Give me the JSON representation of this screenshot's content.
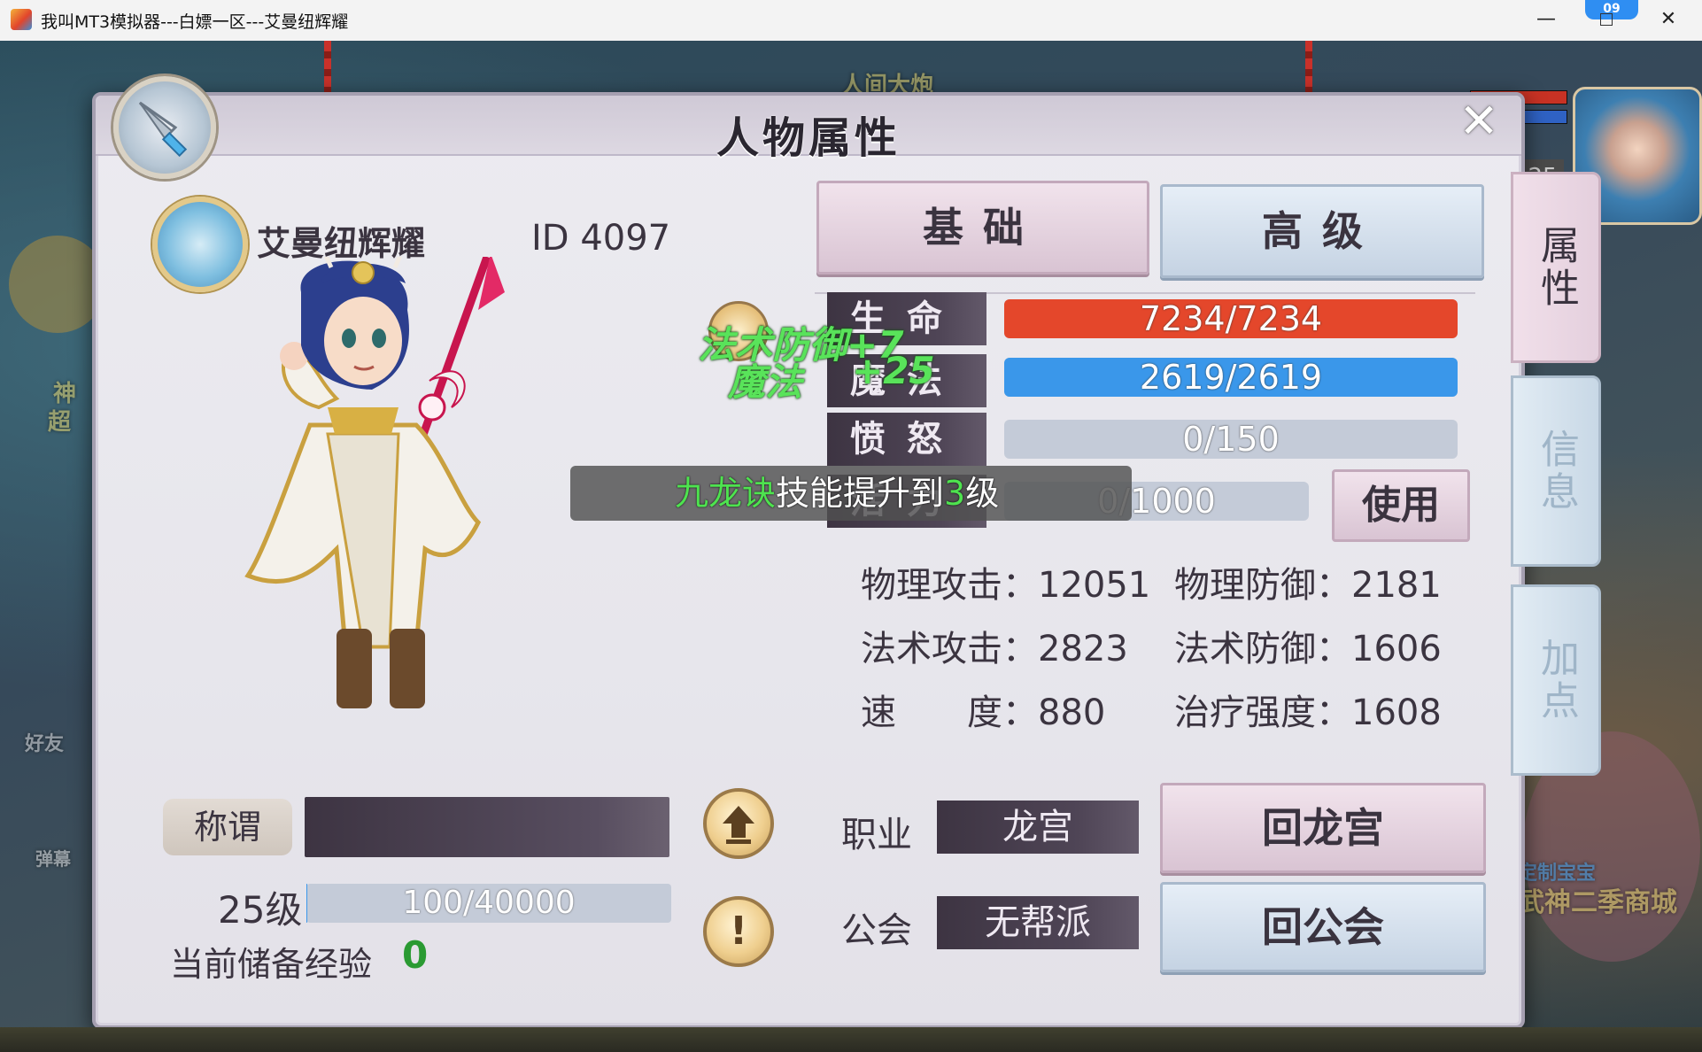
{
  "window": {
    "title": "我叫MT3模拟器---白嫖一区---艾曼纽辉耀",
    "minimize": "—",
    "close": "✕",
    "badge": "09"
  },
  "background": {
    "left_text_1": "神",
    "left_text_2": "超",
    "left_text_3": "好友",
    "left_text_4": "弹幕",
    "right_text_1": "定制宝宝",
    "right_text_2": "武神二季商城",
    "top_text": "人间大炮",
    "hud_level": "25",
    "bottom_left": "经验"
  },
  "panel": {
    "title": "人物属性",
    "close": "✕"
  },
  "character": {
    "name": "艾曼纽辉耀",
    "id": "ID 4097"
  },
  "tabs": {
    "basic": "基础",
    "advanced": "高级"
  },
  "side_tabs": {
    "attributes": "属性",
    "info": "信息",
    "add_points": "加点"
  },
  "stats": {
    "hp_label": "生命",
    "hp_value": "7234/7234",
    "hp_ratio": 1.0,
    "mp_label": "魔法",
    "mp_value": "2619/2619",
    "mp_ratio": 1.0,
    "rage_label": "愤怒",
    "rage_value": "0/150",
    "rage_ratio": 0,
    "vit_label": "活力",
    "vit_value": "0/1000",
    "vit_ratio": 0,
    "use_button": "使用"
  },
  "attributes": {
    "phys_atk_label": "物理攻击：",
    "phys_atk": "12051",
    "phys_def_label": "物理防御：",
    "phys_def": "2181",
    "mag_atk_label": "法术攻击：",
    "mag_atk": "2823",
    "mag_def_label": "法术防御：",
    "mag_def": "1606",
    "speed_label": "速　　度：",
    "speed": "880",
    "heal_label": "治疗强度：",
    "heal": "1608"
  },
  "floating": {
    "line1": "法术防御+7",
    "line2a": "魔法",
    "line2b": "+25"
  },
  "toast": {
    "skill": "九龙诀",
    "middle": "技能提升到",
    "level": "3",
    "suffix": "级"
  },
  "bottom": {
    "title_label": "称谓",
    "level": "25级",
    "exp": "100/40000",
    "exp_ratio": 0.0025,
    "reserve_label": "当前储备经验",
    "reserve_value": "0",
    "job_label": "职业",
    "job_value": "龙宫",
    "guild_label": "公会",
    "guild_value": "无帮派",
    "return_dragon": "回龙宫",
    "return_guild": "回公会"
  },
  "colors": {
    "hp": "#e4472b",
    "mp": "#3a97ea",
    "green": "#4ee34f"
  }
}
